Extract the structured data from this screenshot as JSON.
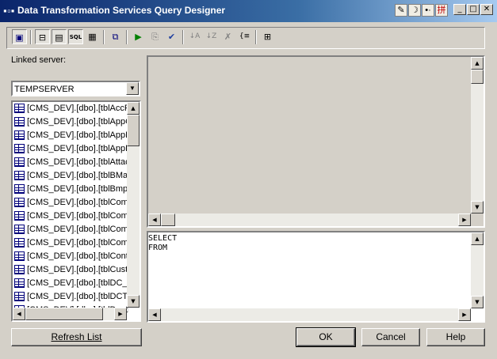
{
  "window": {
    "title": "Data Transformation Services Query Designer",
    "app_icon": "query-designer-icon",
    "ime_icons": [
      "ime-mode-icon",
      "moon-icon",
      "dot-icon",
      "pinyin-icon"
    ],
    "ime_glyphs": [
      "✎",
      "☽",
      "•·",
      "拼"
    ],
    "controls": {
      "minimize": "_",
      "maximize": "□",
      "close": "✕"
    }
  },
  "toolbar": {
    "buttons": [
      {
        "name": "show-diagram-pane-icon",
        "glyph": "▣"
      },
      {
        "name": "show-grid-pane-icon",
        "glyph": "⊟"
      },
      {
        "name": "show-results-pane-icon",
        "glyph": "▤"
      },
      {
        "name": "show-sql-pane-icon",
        "glyph": "SQL"
      },
      {
        "name": "show-results-icon",
        "glyph": "▦"
      },
      {
        "name": "change-type-icon",
        "glyph": "⧉"
      },
      {
        "name": "run-icon",
        "glyph": "▶"
      },
      {
        "name": "copy-icon",
        "glyph": "⎘"
      },
      {
        "name": "verify-sql-icon",
        "glyph": "✔"
      },
      {
        "name": "sort-ascending-icon",
        "glyph": "↓A"
      },
      {
        "name": "sort-descending-icon",
        "glyph": "↓Z"
      },
      {
        "name": "remove-filter-icon",
        "glyph": "✗"
      },
      {
        "name": "group-by-icon",
        "glyph": "{≡"
      },
      {
        "name": "add-table-icon",
        "glyph": "⊞"
      }
    ]
  },
  "linked_server": {
    "label": "Linked server:",
    "selected": "TEMPSERVER"
  },
  "table_list": {
    "items": [
      "[CMS_DEV].[dbo].[tblAccR",
      "[CMS_DEV].[dbo].[tblAppC",
      "[CMS_DEV].[dbo].[tblAppF",
      "[CMS_DEV].[dbo].[tblAppF",
      "[CMS_DEV].[dbo].[tblAttac",
      "[CMS_DEV].[dbo].[tblBMap",
      "[CMS_DEV].[dbo].[tblBmpS",
      "[CMS_DEV].[dbo].[tblComn",
      "[CMS_DEV].[dbo].[tblComn",
      "[CMS_DEV].[dbo].[tblComn",
      "[CMS_DEV].[dbo].[tblComn",
      "[CMS_DEV].[dbo].[tblContr",
      "[CMS_DEV].[dbo].[tblCusto",
      "[CMS_DEV].[dbo].[tblDC_F",
      "[CMS_DEV].[dbo].[tblDCTr",
      "[CMS_DEV].[dbo].[tblDesti"
    ]
  },
  "sql_pane": {
    "text": "SELECT\nFROM"
  },
  "buttons": {
    "refresh": "Refresh List",
    "ok": "OK",
    "cancel": "Cancel",
    "help": "Help"
  },
  "scroll_glyphs": {
    "up": "▲",
    "down": "▼",
    "left": "◀",
    "right": "▶"
  },
  "colors": {
    "titlebar_start": "#0a246a",
    "titlebar_end": "#a6caf0",
    "face": "#d4d0c8",
    "run_green": "#008000",
    "check_blue": "#1f3f9f"
  }
}
